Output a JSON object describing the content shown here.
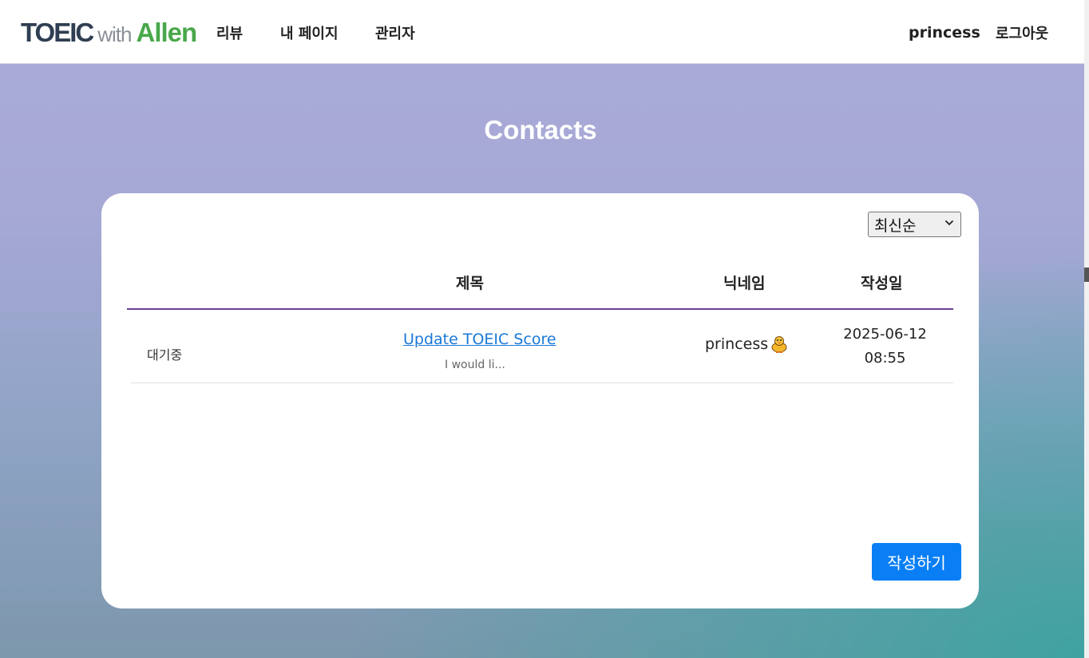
{
  "nav": {
    "logo_part1": "TOEIC",
    "logo_part2": "with",
    "logo_part3": "Allen",
    "links": [
      "리뷰",
      "내 페이지",
      "관리자"
    ],
    "username": "princess",
    "logout": "로그아웃"
  },
  "page": {
    "title": "Contacts"
  },
  "sort": {
    "selected": "최신순"
  },
  "table": {
    "headers": {
      "title": "제목",
      "nickname": "닉네임",
      "date": "작성일"
    },
    "rows": [
      {
        "status": "대기중",
        "title": "Update TOEIC Score",
        "preview": "I would li...",
        "nickname": "princess",
        "date": "2025-06-12",
        "time": "08:55"
      }
    ]
  },
  "actions": {
    "write_label": "작성하기"
  },
  "colors": {
    "accent_blue": "#0a7ff5",
    "header_divider": "#6b3f8f",
    "logo_green": "#49a84a"
  }
}
